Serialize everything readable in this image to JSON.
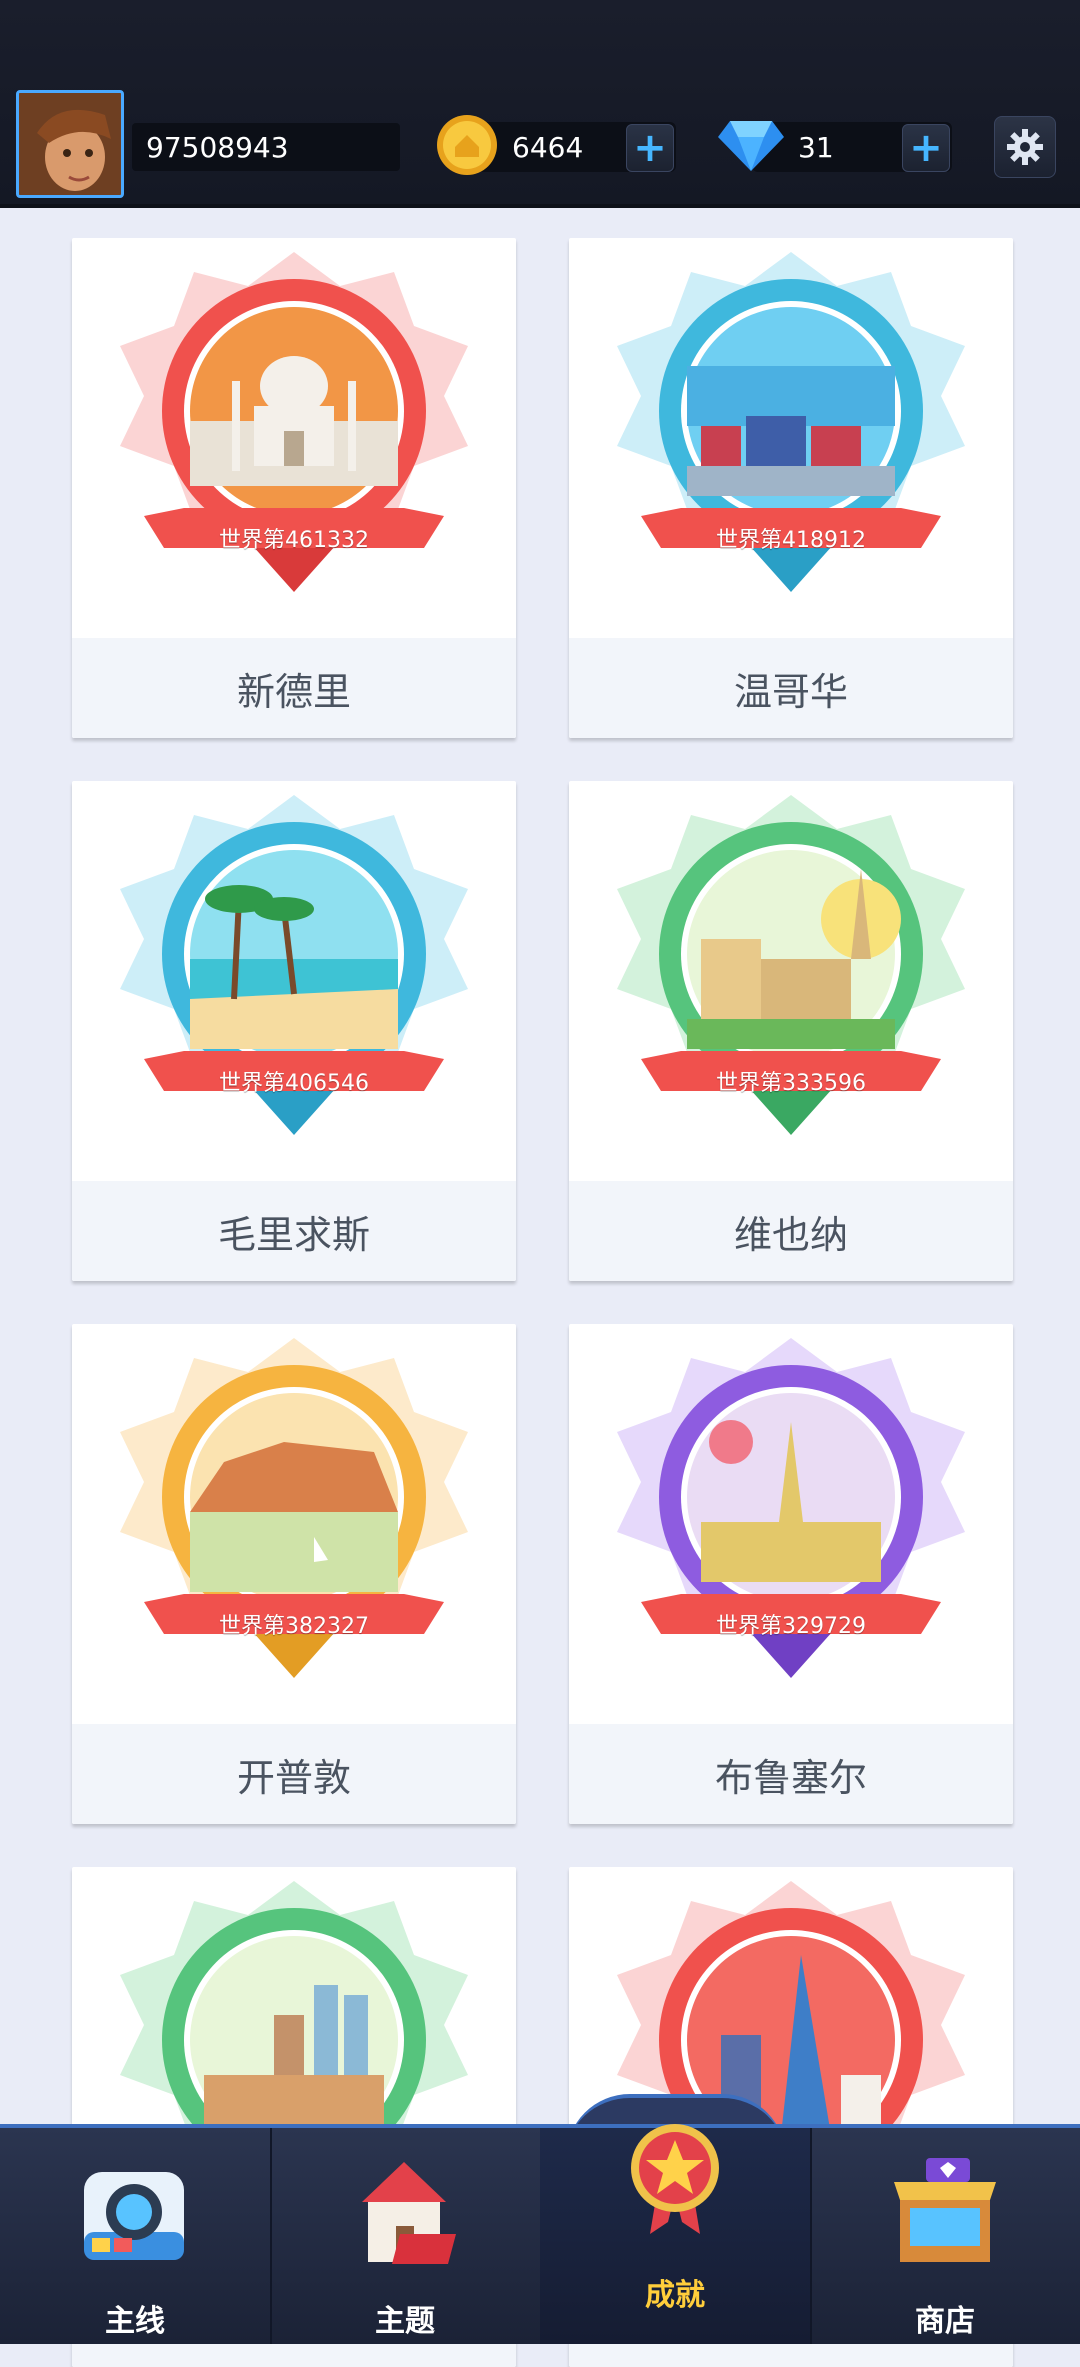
{
  "header": {
    "score": "97508943",
    "coins": "6464",
    "gems": "31",
    "plus_symbol": "+"
  },
  "cards": [
    {
      "name": "新德里",
      "rank": "世界第461332",
      "color": "#f0514d"
    },
    {
      "name": "温哥华",
      "rank": "世界第418912",
      "color": "#3fb8dd"
    },
    {
      "name": "毛里求斯",
      "rank": "世界第406546",
      "color": "#3fb8dd"
    },
    {
      "name": "维也纳",
      "rank": "世界第333596",
      "color": "#56c47d"
    },
    {
      "name": "开普敦",
      "rank": "世界第382327",
      "color": "#f6b440"
    },
    {
      "name": "布鲁塞尔",
      "rank": "世界第329729",
      "color": "#8e5ce0"
    },
    {
      "name": "",
      "rank": "",
      "color": "#56c47d"
    },
    {
      "name": "",
      "rank": "",
      "color": "#f0514d"
    }
  ],
  "nav": {
    "main": "主线",
    "theme": "主题",
    "achievement": "成就",
    "shop": "商店",
    "accent": "#ffce3b"
  }
}
